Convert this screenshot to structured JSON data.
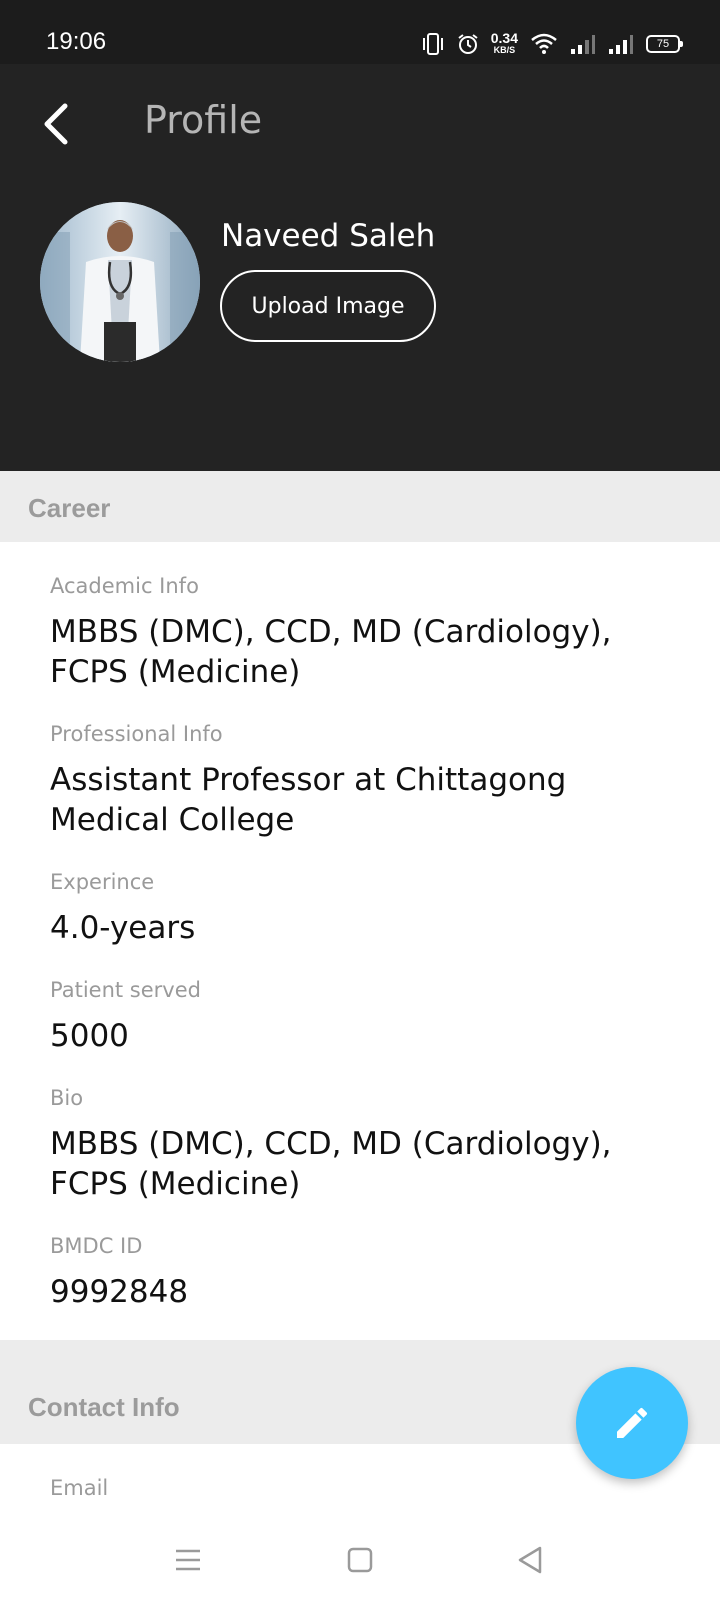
{
  "status_bar": {
    "time": "19:06",
    "net_speed_value": "0.34",
    "net_speed_unit": "KB/S",
    "battery": "75"
  },
  "header": {
    "title": "Profile",
    "user_name": "Naveed Saleh",
    "upload_label": "Upload Image",
    "back_icon": "chevron-left-icon",
    "background_color": "#232323"
  },
  "career": {
    "title": "Career",
    "fields": [
      {
        "label": "Academic Info",
        "value": "MBBS (DMC), CCD, MD (Cardiology), FCPS (Medicine)"
      },
      {
        "label": "Professional Info",
        "value": "Assistant Professor at Chittagong Medical College"
      },
      {
        "label": "Experince",
        "value": "4.0-years"
      },
      {
        "label": "Patient served",
        "value": "5000"
      },
      {
        "label": "Bio",
        "value": "MBBS (DMC), CCD, MD (Cardiology), FCPS (Medicine)"
      },
      {
        "label": "BMDC ID",
        "value": "9992848"
      }
    ]
  },
  "contact": {
    "title": "Contact Info",
    "fields": [
      {
        "label": "Email"
      }
    ]
  },
  "fab": {
    "icon": "pencil-icon",
    "color": "#40c4ff"
  },
  "nav": {
    "menu_icon": "menu-icon",
    "home_icon": "square-icon",
    "back_icon": "triangle-back-icon"
  }
}
